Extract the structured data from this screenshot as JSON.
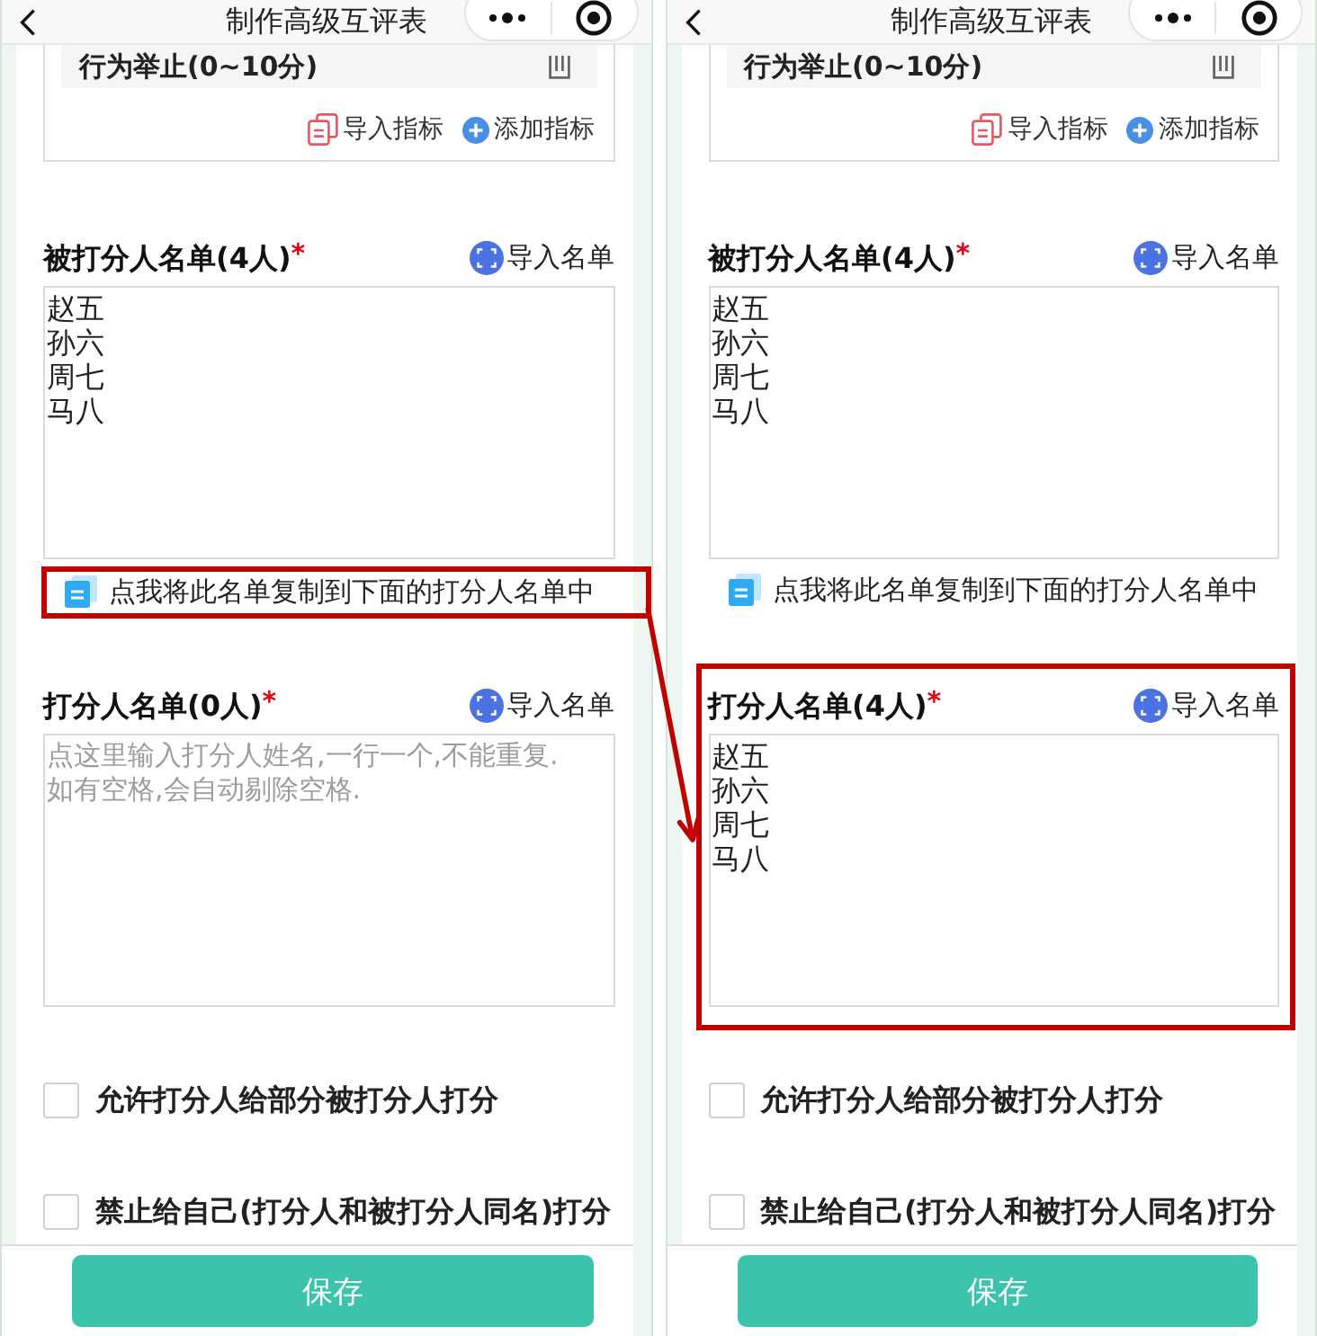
{
  "screens": [
    {
      "nav_bar": {
        "title": "制作高级互评表"
      },
      "criteria": [
        {
          "label": "行为举止(0~10分)"
        }
      ],
      "criteria_actions": [
        {
          "kind": "import",
          "label": "导入指标"
        },
        {
          "kind": "add",
          "label": "添加指标"
        }
      ],
      "lists": [
        {
          "label": "被打分人名单(4人)",
          "required_mark": "*",
          "import_label": "导入名单",
          "value": [
            "赵五",
            "孙六",
            "周七",
            "马八"
          ],
          "copy_link": {
            "label": "点我将此名单复制到下面的打分人名单中",
            "highlighted": true
          }
        },
        {
          "label": "打分人名单(0人)",
          "required_mark": "*",
          "import_label": "导入名单",
          "placeholder": "点这里输入打分人姓名,一行一个,不能重复.如有空格,会自动剔除空格."
        }
      ],
      "options": [
        {
          "label": "允许打分人给部分被打分人打分",
          "checked": false
        },
        {
          "label": "禁止给自己(打分人和被打分人同名)打分",
          "checked": false
        }
      ],
      "save_button": "保存"
    },
    {
      "nav_bar": {
        "title": "制作高级互评表"
      },
      "criteria": [
        {
          "label": "行为举止(0~10分)"
        }
      ],
      "criteria_actions": [
        {
          "kind": "import",
          "label": "导入指标"
        },
        {
          "kind": "add",
          "label": "添加指标"
        }
      ],
      "lists": [
        {
          "label": "被打分人名单(4人)",
          "required_mark": "*",
          "import_label": "导入名单",
          "value": [
            "赵五",
            "孙六",
            "周七",
            "马八"
          ],
          "copy_link": {
            "label": "点我将此名单复制到下面的打分人名单中"
          }
        },
        {
          "label": "打分人名单(4人)",
          "required_mark": "*",
          "import_label": "导入名单",
          "value": [
            "赵五",
            "孙六",
            "周七",
            "马八"
          ],
          "highlighted": true
        }
      ],
      "options": [
        {
          "label": "允许打分人给部分被打分人打分",
          "checked": false
        },
        {
          "label": "禁止给自己(打分人和被打分人同名)打分",
          "checked": false
        }
      ],
      "save_button": "保存"
    }
  ]
}
